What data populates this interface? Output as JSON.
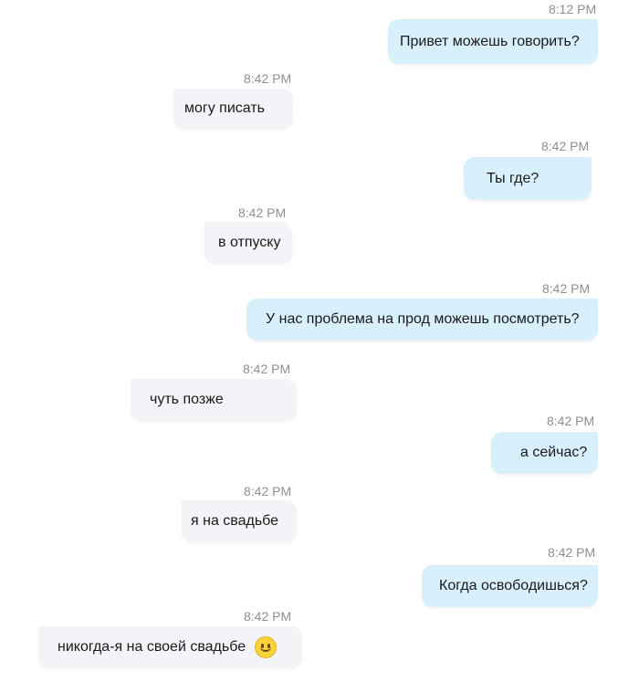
{
  "messages": [
    {
      "time": "8:12 PM",
      "text": "Привет можешь говорить?"
    },
    {
      "time": "8:42 PM",
      "text": "могу писать"
    },
    {
      "time": "8:42 PM",
      "text": "Ты где?"
    },
    {
      "time": "8:42 PM",
      "text": "в отпуску"
    },
    {
      "time": "8:42 PM",
      "text": "У нас проблема на прод можешь посмотреть?"
    },
    {
      "time": "8:42 PM",
      "text": "чуть позже"
    },
    {
      "time": "8:42 PM",
      "text": "а сейчас?"
    },
    {
      "time": "8:42 PM",
      "text": "я на свадьбе"
    },
    {
      "time": "8:42 PM",
      "text": "Когда освободишься?"
    },
    {
      "time": "8:42 PM",
      "text": "никогда-я на своей свадьбе",
      "emoji": "slightly-smiling-face-icon"
    }
  ],
  "colors": {
    "outgoing_bubble": "#d8f0fc",
    "incoming_bubble": "#f2f4f7",
    "timestamp": "#8f8f8f"
  }
}
